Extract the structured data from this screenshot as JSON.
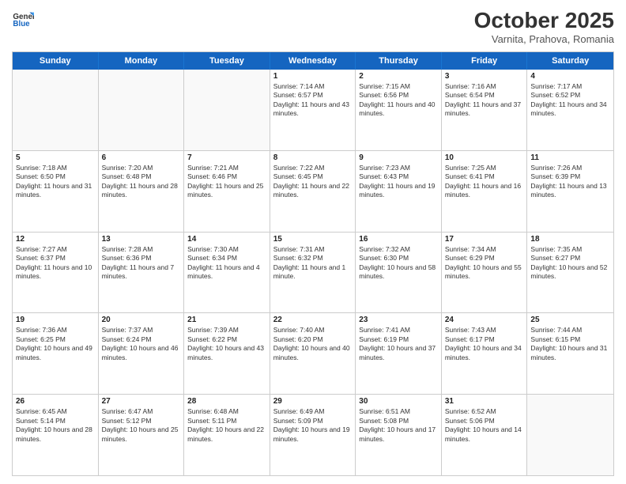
{
  "header": {
    "logo_line1": "General",
    "logo_line2": "Blue",
    "month": "October 2025",
    "location": "Varnita, Prahova, Romania"
  },
  "days_of_week": [
    "Sunday",
    "Monday",
    "Tuesday",
    "Wednesday",
    "Thursday",
    "Friday",
    "Saturday"
  ],
  "weeks": [
    [
      {
        "day": "",
        "text": ""
      },
      {
        "day": "",
        "text": ""
      },
      {
        "day": "",
        "text": ""
      },
      {
        "day": "1",
        "text": "Sunrise: 7:14 AM\nSunset: 6:57 PM\nDaylight: 11 hours and 43 minutes."
      },
      {
        "day": "2",
        "text": "Sunrise: 7:15 AM\nSunset: 6:56 PM\nDaylight: 11 hours and 40 minutes."
      },
      {
        "day": "3",
        "text": "Sunrise: 7:16 AM\nSunset: 6:54 PM\nDaylight: 11 hours and 37 minutes."
      },
      {
        "day": "4",
        "text": "Sunrise: 7:17 AM\nSunset: 6:52 PM\nDaylight: 11 hours and 34 minutes."
      }
    ],
    [
      {
        "day": "5",
        "text": "Sunrise: 7:18 AM\nSunset: 6:50 PM\nDaylight: 11 hours and 31 minutes."
      },
      {
        "day": "6",
        "text": "Sunrise: 7:20 AM\nSunset: 6:48 PM\nDaylight: 11 hours and 28 minutes."
      },
      {
        "day": "7",
        "text": "Sunrise: 7:21 AM\nSunset: 6:46 PM\nDaylight: 11 hours and 25 minutes."
      },
      {
        "day": "8",
        "text": "Sunrise: 7:22 AM\nSunset: 6:45 PM\nDaylight: 11 hours and 22 minutes."
      },
      {
        "day": "9",
        "text": "Sunrise: 7:23 AM\nSunset: 6:43 PM\nDaylight: 11 hours and 19 minutes."
      },
      {
        "day": "10",
        "text": "Sunrise: 7:25 AM\nSunset: 6:41 PM\nDaylight: 11 hours and 16 minutes."
      },
      {
        "day": "11",
        "text": "Sunrise: 7:26 AM\nSunset: 6:39 PM\nDaylight: 11 hours and 13 minutes."
      }
    ],
    [
      {
        "day": "12",
        "text": "Sunrise: 7:27 AM\nSunset: 6:37 PM\nDaylight: 11 hours and 10 minutes."
      },
      {
        "day": "13",
        "text": "Sunrise: 7:28 AM\nSunset: 6:36 PM\nDaylight: 11 hours and 7 minutes."
      },
      {
        "day": "14",
        "text": "Sunrise: 7:30 AM\nSunset: 6:34 PM\nDaylight: 11 hours and 4 minutes."
      },
      {
        "day": "15",
        "text": "Sunrise: 7:31 AM\nSunset: 6:32 PM\nDaylight: 11 hours and 1 minute."
      },
      {
        "day": "16",
        "text": "Sunrise: 7:32 AM\nSunset: 6:30 PM\nDaylight: 10 hours and 58 minutes."
      },
      {
        "day": "17",
        "text": "Sunrise: 7:34 AM\nSunset: 6:29 PM\nDaylight: 10 hours and 55 minutes."
      },
      {
        "day": "18",
        "text": "Sunrise: 7:35 AM\nSunset: 6:27 PM\nDaylight: 10 hours and 52 minutes."
      }
    ],
    [
      {
        "day": "19",
        "text": "Sunrise: 7:36 AM\nSunset: 6:25 PM\nDaylight: 10 hours and 49 minutes."
      },
      {
        "day": "20",
        "text": "Sunrise: 7:37 AM\nSunset: 6:24 PM\nDaylight: 10 hours and 46 minutes."
      },
      {
        "day": "21",
        "text": "Sunrise: 7:39 AM\nSunset: 6:22 PM\nDaylight: 10 hours and 43 minutes."
      },
      {
        "day": "22",
        "text": "Sunrise: 7:40 AM\nSunset: 6:20 PM\nDaylight: 10 hours and 40 minutes."
      },
      {
        "day": "23",
        "text": "Sunrise: 7:41 AM\nSunset: 6:19 PM\nDaylight: 10 hours and 37 minutes."
      },
      {
        "day": "24",
        "text": "Sunrise: 7:43 AM\nSunset: 6:17 PM\nDaylight: 10 hours and 34 minutes."
      },
      {
        "day": "25",
        "text": "Sunrise: 7:44 AM\nSunset: 6:15 PM\nDaylight: 10 hours and 31 minutes."
      }
    ],
    [
      {
        "day": "26",
        "text": "Sunrise: 6:45 AM\nSunset: 5:14 PM\nDaylight: 10 hours and 28 minutes."
      },
      {
        "day": "27",
        "text": "Sunrise: 6:47 AM\nSunset: 5:12 PM\nDaylight: 10 hours and 25 minutes."
      },
      {
        "day": "28",
        "text": "Sunrise: 6:48 AM\nSunset: 5:11 PM\nDaylight: 10 hours and 22 minutes."
      },
      {
        "day": "29",
        "text": "Sunrise: 6:49 AM\nSunset: 5:09 PM\nDaylight: 10 hours and 19 minutes."
      },
      {
        "day": "30",
        "text": "Sunrise: 6:51 AM\nSunset: 5:08 PM\nDaylight: 10 hours and 17 minutes."
      },
      {
        "day": "31",
        "text": "Sunrise: 6:52 AM\nSunset: 5:06 PM\nDaylight: 10 hours and 14 minutes."
      },
      {
        "day": "",
        "text": ""
      }
    ]
  ]
}
